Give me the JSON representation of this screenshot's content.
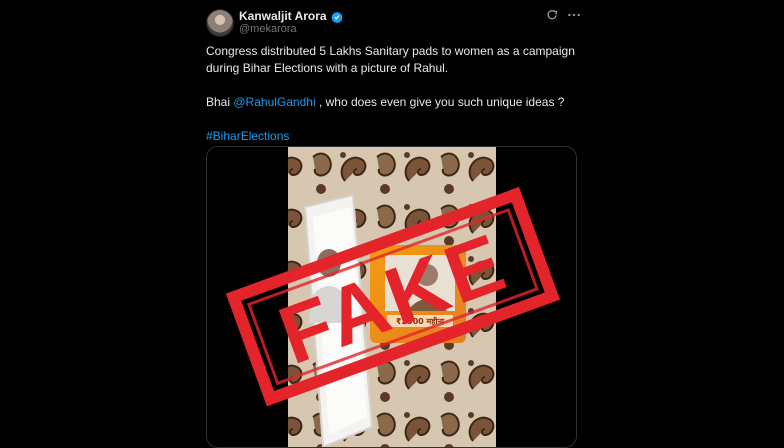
{
  "tweet": {
    "author": {
      "name": "Kanwaljit Arora",
      "handle": "@mekarora",
      "avatar_icon": "user-avatar",
      "verified_icon": "verified-badge-icon"
    },
    "line1": "Congress distributed 5 Lakhs Sanitary pads to women as a campaign",
    "line2": "during Bihar Elections with a picture of Rahul.",
    "line3_prefix": "Bhai",
    "mention": "@RahulGandhi",
    "line3_suffix": ", who does even give you such unique ideas ?",
    "hashtag": "#BiharElections",
    "media": {
      "stamp_text": "FAKE",
      "package_text": "₹2500 महीना",
      "stamp_color": "#e3242b"
    }
  },
  "colors": {
    "background": "#000000",
    "text": "#e7e9ea",
    "muted": "#71767b",
    "link": "#1d9bf0",
    "verified": "#1d9bf0"
  },
  "icons": [
    "grok-icon",
    "more-options-icon",
    "verified-badge-icon"
  ]
}
